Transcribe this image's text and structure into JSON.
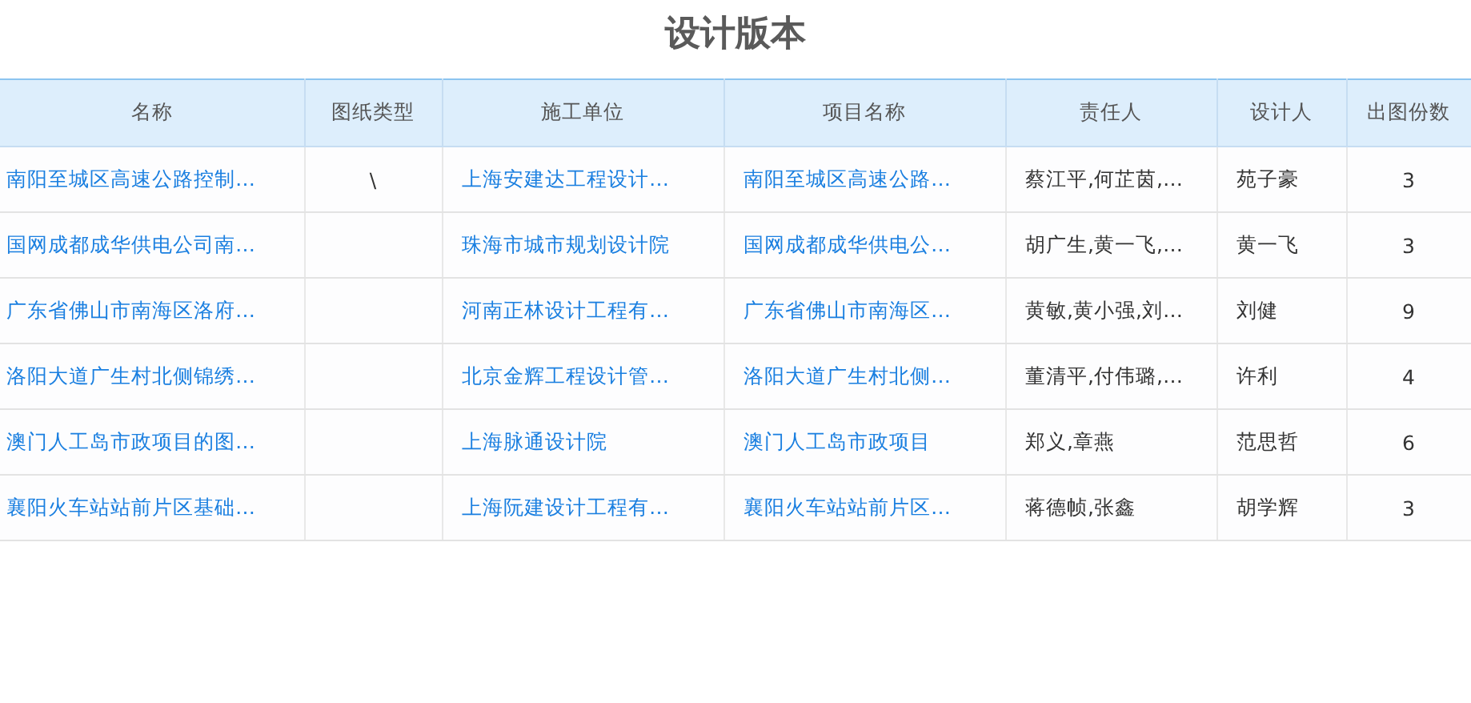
{
  "title": "设计版本",
  "table": {
    "columns": [
      {
        "label": "名称",
        "kind": "link"
      },
      {
        "label": "图纸类型",
        "kind": "center"
      },
      {
        "label": "施工单位",
        "kind": "link"
      },
      {
        "label": "项目名称",
        "kind": "link"
      },
      {
        "label": "责任人",
        "kind": "text"
      },
      {
        "label": "设计人",
        "kind": "text"
      },
      {
        "label": "出图份数",
        "kind": "center"
      }
    ],
    "rows": [
      [
        "南阳至城区高速公路控制…",
        "\\",
        "上海安建达工程设计…",
        "南阳至城区高速公路…",
        "蔡江平,何芷茵,…",
        "苑子豪",
        "3"
      ],
      [
        "国网成都成华供电公司南…",
        "",
        "珠海市城市规划设计院",
        "国网成都成华供电公…",
        "胡广生,黄一飞,…",
        "黄一飞",
        "3"
      ],
      [
        "广东省佛山市南海区洛府…",
        "",
        "河南正林设计工程有…",
        "广东省佛山市南海区…",
        "黄敏,黄小强,刘…",
        "刘健",
        "9"
      ],
      [
        "洛阳大道广生村北侧锦绣…",
        "",
        "北京金辉工程设计管…",
        "洛阳大道广生村北侧…",
        "董清平,付伟璐,…",
        "许利",
        "4"
      ],
      [
        "澳门人工岛市政项目的图…",
        "",
        "上海脉通设计院",
        "澳门人工岛市政项目",
        "郑义,章燕",
        "范思哲",
        "6"
      ],
      [
        "襄阳火车站站前片区基础…",
        "",
        "上海阮建设计工程有…",
        "襄阳火车站站前片区…",
        "蒋德帧,张鑫",
        "胡学辉",
        "3"
      ]
    ]
  }
}
